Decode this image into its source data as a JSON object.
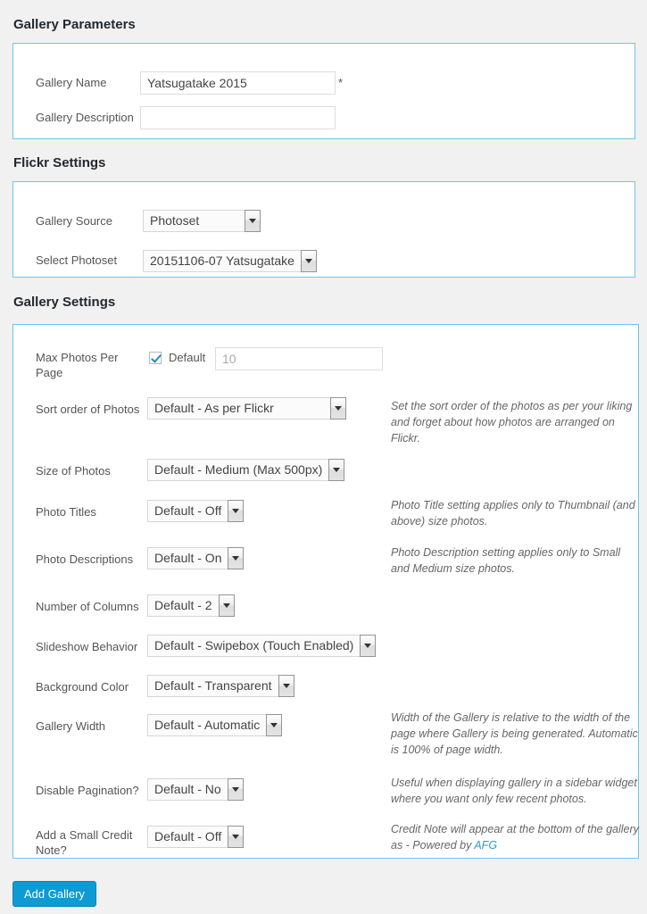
{
  "sections": {
    "gallery_parameters": {
      "title": "Gallery Parameters",
      "fields": {
        "gallery_name": {
          "label": "Gallery Name",
          "value": "Yatsugatake 2015",
          "placeholder": "",
          "required_marker": "*"
        },
        "gallery_description": {
          "label": "Gallery Description",
          "value": "",
          "placeholder": ""
        }
      }
    },
    "flickr_settings": {
      "title": "Flickr Settings",
      "fields": {
        "gallery_source": {
          "label": "Gallery Source",
          "value": "Photoset"
        },
        "select_photoset": {
          "label": "Select Photoset",
          "value": "20151106-07 Yatsugatake"
        }
      }
    },
    "gallery_settings": {
      "title": "Gallery Settings",
      "fields": {
        "max_photos_per_page": {
          "label": "Max Photos Per Page",
          "checkbox_label": "Default",
          "checked": true,
          "value": "",
          "placeholder": "10"
        },
        "sort_order": {
          "label": "Sort order of Photos",
          "value": "Default - As per Flickr",
          "help": "Set the sort order of the photos as per your liking and forget about how photos are arranged on Flickr."
        },
        "size_of_photos": {
          "label": "Size of Photos",
          "value": "Default - Medium (Max 500px)",
          "help": ""
        },
        "photo_titles": {
          "label": "Photo Titles",
          "value": "Default - Off",
          "help": "Photo Title setting applies only to Thumbnail (and above) size photos."
        },
        "photo_descriptions": {
          "label": "Photo Descriptions",
          "value": "Default - On",
          "help": "Photo Description setting applies only to Small and Medium size photos."
        },
        "number_of_columns": {
          "label": "Number of Columns",
          "value": "Default - 2",
          "help": ""
        },
        "slideshow_behavior": {
          "label": "Slideshow Behavior",
          "value": "Default - Swipebox (Touch Enabled)",
          "help": ""
        },
        "background_color": {
          "label": "Background Color",
          "value": "Default - Transparent",
          "help": ""
        },
        "gallery_width": {
          "label": "Gallery Width",
          "value": "Default - Automatic",
          "help": "Width of the Gallery is relative to the width of the page where Gallery is being generated. Automatic is 100% of page width."
        },
        "disable_pagination": {
          "label": "Disable Pagination?",
          "value": "Default - No",
          "help": "Useful when displaying gallery in a sidebar widget where you want only few recent photos."
        },
        "credit_note": {
          "label": "Add a Small Credit Note?",
          "value": "Default - Off",
          "help_prefix": "Credit Note will appear at the bottom of the gallery as - Powered by ",
          "help_link": "AFG"
        }
      }
    }
  },
  "submit": {
    "label": "Add Gallery"
  },
  "colors": {
    "panel_border": "#6ec5e8",
    "page_background": "#f1f1f1",
    "primary_button": "#0e9bd4",
    "link": "#3399cc",
    "checkbox_check": "#1e8cbe"
  }
}
